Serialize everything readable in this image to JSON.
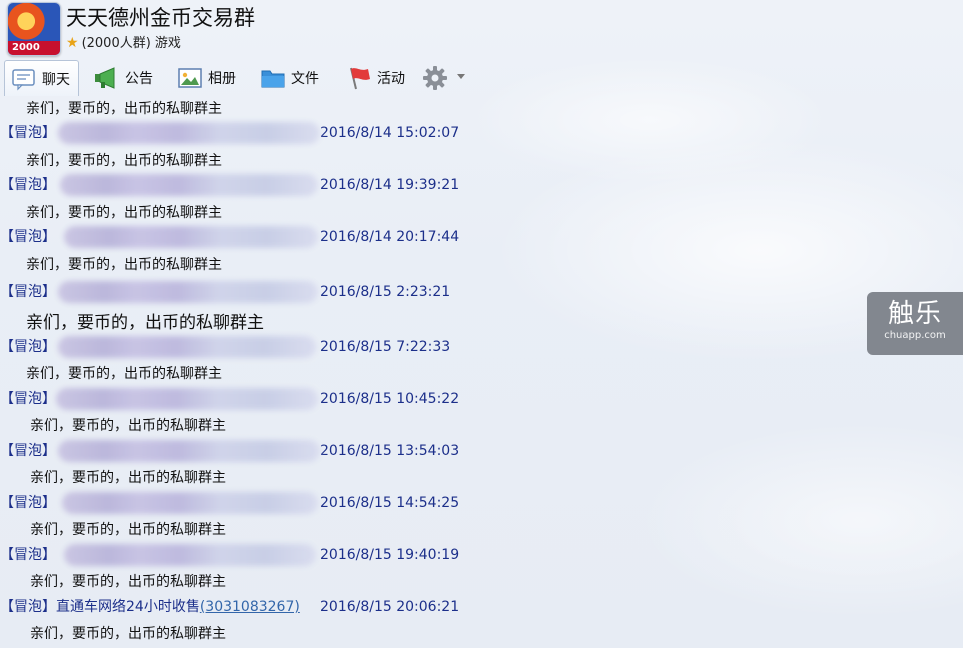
{
  "header": {
    "title": "天天德州金币交易群",
    "subtitle": "(2000人群) 游戏",
    "avatar_badge": "2000"
  },
  "toolbar": {
    "items": [
      {
        "label": "聊天",
        "icon": "chat-icon"
      },
      {
        "label": "公告",
        "icon": "megaphone-icon"
      },
      {
        "label": "相册",
        "icon": "photo-album-icon"
      },
      {
        "label": "文件",
        "icon": "folder-icon"
      },
      {
        "label": "活动",
        "icon": "flag-icon"
      }
    ],
    "settings_icon": "gear-icon"
  },
  "chat": {
    "top_partial_body": "亲们，要币的，出币的私聊群主",
    "messages": [
      {
        "tag": "【冒泡】",
        "sender": "",
        "qq": "",
        "time": "2016/8/14 15:02:07",
        "body": "亲们，要币的，出币的私聊群主"
      },
      {
        "tag": "【冒泡】",
        "sender": "",
        "qq": "",
        "time": "2016/8/14 19:39:21",
        "body": "亲们，要币的，出币的私聊群主"
      },
      {
        "tag": "【冒泡】",
        "sender": "",
        "qq": "",
        "time": "2016/8/14 20:17:44",
        "body": "亲们，要币的，出币的私聊群主"
      },
      {
        "tag": "【冒泡】",
        "sender": "",
        "qq": "",
        "time": "2016/8/15 2:23:21",
        "body": "亲们，要币的，出币的私聊群主"
      },
      {
        "tag": "【冒泡】",
        "sender": "",
        "qq": "",
        "time": "2016/8/15 7:22:33",
        "body": "亲们，要币的，出币的私聊群主"
      },
      {
        "tag": "【冒泡】",
        "sender": "",
        "qq": "",
        "time": "2016/8/15 10:45:22",
        "body": "亲们，要币的，出币的私聊群主"
      },
      {
        "tag": "【冒泡】",
        "sender": "",
        "qq": "",
        "time": "2016/8/15 13:54:03",
        "body": "亲们，要币的，出币的私聊群主"
      },
      {
        "tag": "【冒泡】",
        "sender": "",
        "qq": "",
        "time": "2016/8/15 14:54:25",
        "body": "亲们，要币的，出币的私聊群主"
      },
      {
        "tag": "【冒泡】",
        "sender": "",
        "qq": "",
        "time": "2016/8/15 19:40:19",
        "body": "亲们，要币的，出币的私聊群主"
      },
      {
        "tag": "【冒泡】",
        "sender": "直通车网络24小时收售",
        "qq": "(3031083267)",
        "time": "2016/8/15 20:06:21",
        "body": "亲们，要币的，出币的私聊群主"
      }
    ]
  },
  "watermark": {
    "main": "触乐",
    "sub": "chuapp.com"
  },
  "colors": {
    "header_text": "#1c2f8a",
    "link": "#3366aa",
    "background": "#e9eef6"
  }
}
